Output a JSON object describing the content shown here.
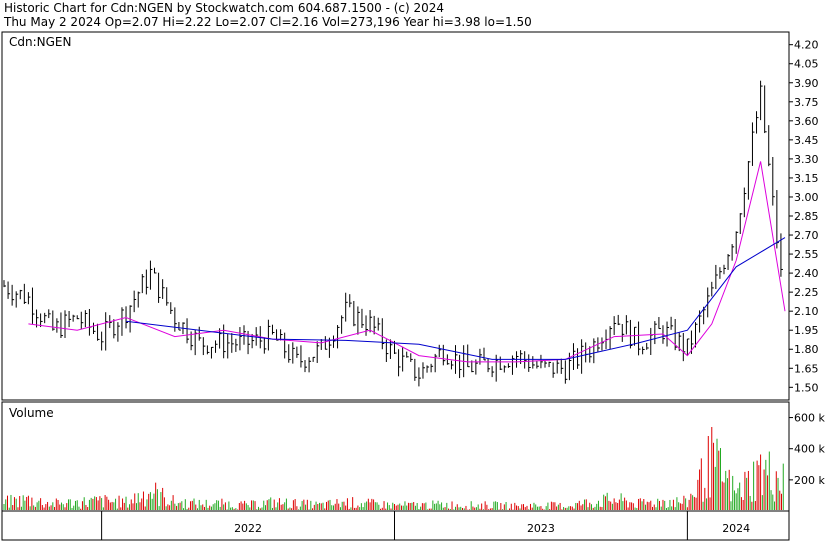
{
  "header": {
    "line1": "Historic Chart for Cdn:NGEN by Stockwatch.com 604.687.1500 - (c) 2024",
    "line2": "Thu May  2 2024  Op=2.07  Hi=2.22  Lo=2.07  Cl=2.16  Vol=273,196  Year hi=3.98  lo=1.50"
  },
  "colors": {
    "ohlc": "#000000",
    "ma_short": "#dd00dd",
    "ma_long": "#0000cc",
    "volume_up": "#22aa22",
    "volume_down": "#dd0000",
    "frame": "#000000"
  },
  "chart_data": [
    {
      "type": "line",
      "panel": "price",
      "label": "Cdn:NGEN",
      "x_range": [
        "2021-09",
        "2024-05"
      ],
      "ylim": [
        1.4,
        4.3
      ],
      "y_ticks": [
        "4.20",
        "4.05",
        "3.90",
        "3.75",
        "3.60",
        "3.45",
        "3.30",
        "3.15",
        "3.00",
        "2.85",
        "2.70",
        "2.55",
        "2.40",
        "2.25",
        "2.10",
        "1.95",
        "1.80",
        "1.65",
        "1.50"
      ],
      "x_ticks": [
        "2022",
        "2023",
        "2024"
      ],
      "grid": false,
      "series": [
        {
          "style": "ohlc-bars",
          "color": "#000000",
          "x": [
            "2021-09",
            "2021-10",
            "2021-11",
            "2021-12",
            "2022-01",
            "2022-02",
            "2022-03",
            "2022-04",
            "2022-05",
            "2022-06",
            "2022-07",
            "2022-08",
            "2022-09",
            "2022-10",
            "2022-11",
            "2022-12",
            "2023-01",
            "2023-02",
            "2023-03",
            "2023-04",
            "2023-05",
            "2023-06",
            "2023-07",
            "2023-08",
            "2023-09",
            "2023-10",
            "2023-11",
            "2023-12",
            "2024-01",
            "2024-02",
            "2024-03",
            "2024-04",
            "2024-05"
          ],
          "close": [
            2.3,
            2.2,
            1.95,
            2.05,
            1.9,
            2.1,
            2.4,
            2.05,
            1.85,
            1.85,
            1.85,
            1.9,
            1.7,
            1.8,
            2.1,
            2.0,
            1.75,
            1.6,
            1.8,
            1.65,
            1.7,
            1.75,
            1.65,
            1.65,
            1.8,
            2.05,
            1.85,
            1.95,
            1.8,
            2.25,
            2.75,
            3.8,
            2.1
          ]
        },
        {
          "style": "moving-average-short",
          "color": "#dd00dd",
          "x": [
            "2021-10",
            "2021-12",
            "2022-02",
            "2022-04",
            "2022-06",
            "2022-08",
            "2022-10",
            "2022-12",
            "2023-02",
            "2023-04",
            "2023-06",
            "2023-08",
            "2023-10",
            "2023-12",
            "2024-01",
            "2024-02",
            "2024-03",
            "2024-04",
            "2024-05"
          ],
          "values": [
            2.0,
            1.95,
            2.05,
            1.9,
            1.95,
            1.88,
            1.85,
            1.95,
            1.75,
            1.7,
            1.7,
            1.72,
            1.9,
            1.92,
            1.75,
            2.0,
            2.5,
            3.28,
            2.1
          ]
        },
        {
          "style": "moving-average-long",
          "color": "#0000cc",
          "x": [
            "2022-02",
            "2022-05",
            "2022-08",
            "2022-11",
            "2023-02",
            "2023-05",
            "2023-08",
            "2023-11",
            "2024-01",
            "2024-03",
            "2024-05"
          ],
          "values": [
            2.02,
            1.95,
            1.88,
            1.87,
            1.84,
            1.72,
            1.72,
            1.85,
            1.95,
            2.45,
            2.68
          ]
        }
      ]
    },
    {
      "type": "bar",
      "panel": "volume",
      "label": "Volume",
      "ylim": [
        0,
        700000
      ],
      "y_ticks": [
        "600 k",
        "400 k",
        "200 k"
      ],
      "x": [
        "2021-09",
        "2021-10",
        "2021-11",
        "2021-12",
        "2022-01",
        "2022-02",
        "2022-03",
        "2022-04",
        "2022-05",
        "2022-06",
        "2022-07",
        "2022-08",
        "2022-09",
        "2022-10",
        "2022-11",
        "2022-12",
        "2023-01",
        "2023-02",
        "2023-03",
        "2023-04",
        "2023-05",
        "2023-06",
        "2023-07",
        "2023-08",
        "2023-09",
        "2023-10",
        "2023-11",
        "2023-12",
        "2024-01",
        "2024-02",
        "2024-03",
        "2024-04",
        "2024-05"
      ],
      "values": [
        60000,
        80000,
        50000,
        60000,
        70000,
        60000,
        140000,
        60000,
        50000,
        50000,
        40000,
        60000,
        50000,
        40000,
        60000,
        50000,
        40000,
        40000,
        45000,
        40000,
        40000,
        35000,
        40000,
        35000,
        60000,
        80000,
        50000,
        70000,
        60000,
        350000,
        120000,
        280000,
        220000
      ],
      "colors": [
        "up",
        "down"
      ]
    }
  ]
}
